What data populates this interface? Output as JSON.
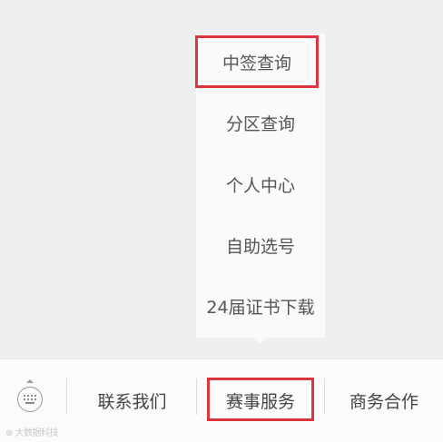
{
  "popup_menu": {
    "items": [
      {
        "label": "中签查询"
      },
      {
        "label": "分区查询"
      },
      {
        "label": "个人中心"
      },
      {
        "label": "自助选号"
      },
      {
        "label": "24届证书下载"
      }
    ]
  },
  "bottom_bar": {
    "tabs": [
      {
        "label": "联系我们"
      },
      {
        "label": "赛事服务"
      },
      {
        "label": "商务合作"
      }
    ]
  },
  "watermark": "⊕ 大数据科技",
  "colors": {
    "highlight": "#d9363e",
    "background": "#efefef",
    "menu_bg": "#fafafa"
  }
}
